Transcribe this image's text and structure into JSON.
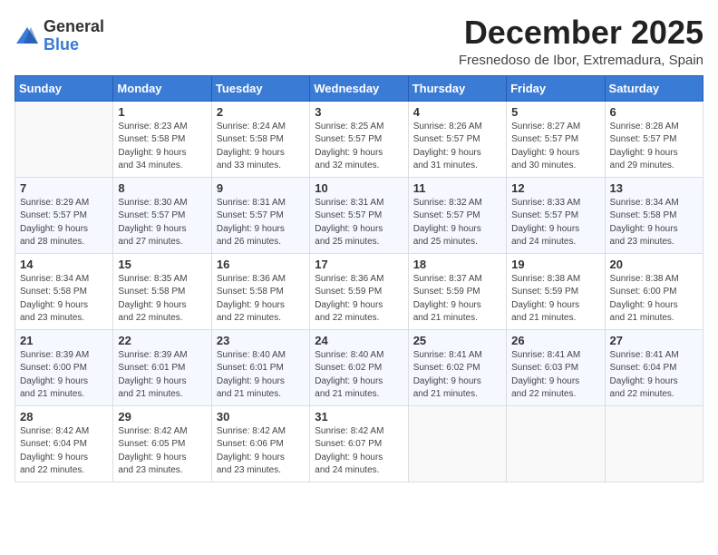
{
  "header": {
    "logo_general": "General",
    "logo_blue": "Blue",
    "month_title": "December 2025",
    "location": "Fresnedoso de Ibor, Extremadura, Spain"
  },
  "weekdays": [
    "Sunday",
    "Monday",
    "Tuesday",
    "Wednesday",
    "Thursday",
    "Friday",
    "Saturday"
  ],
  "weeks": [
    [
      {
        "day": "",
        "info": ""
      },
      {
        "day": "1",
        "info": "Sunrise: 8:23 AM\nSunset: 5:58 PM\nDaylight: 9 hours\nand 34 minutes."
      },
      {
        "day": "2",
        "info": "Sunrise: 8:24 AM\nSunset: 5:58 PM\nDaylight: 9 hours\nand 33 minutes."
      },
      {
        "day": "3",
        "info": "Sunrise: 8:25 AM\nSunset: 5:57 PM\nDaylight: 9 hours\nand 32 minutes."
      },
      {
        "day": "4",
        "info": "Sunrise: 8:26 AM\nSunset: 5:57 PM\nDaylight: 9 hours\nand 31 minutes."
      },
      {
        "day": "5",
        "info": "Sunrise: 8:27 AM\nSunset: 5:57 PM\nDaylight: 9 hours\nand 30 minutes."
      },
      {
        "day": "6",
        "info": "Sunrise: 8:28 AM\nSunset: 5:57 PM\nDaylight: 9 hours\nand 29 minutes."
      }
    ],
    [
      {
        "day": "7",
        "info": "Sunrise: 8:29 AM\nSunset: 5:57 PM\nDaylight: 9 hours\nand 28 minutes."
      },
      {
        "day": "8",
        "info": "Sunrise: 8:30 AM\nSunset: 5:57 PM\nDaylight: 9 hours\nand 27 minutes."
      },
      {
        "day": "9",
        "info": "Sunrise: 8:31 AM\nSunset: 5:57 PM\nDaylight: 9 hours\nand 26 minutes."
      },
      {
        "day": "10",
        "info": "Sunrise: 8:31 AM\nSunset: 5:57 PM\nDaylight: 9 hours\nand 25 minutes."
      },
      {
        "day": "11",
        "info": "Sunrise: 8:32 AM\nSunset: 5:57 PM\nDaylight: 9 hours\nand 25 minutes."
      },
      {
        "day": "12",
        "info": "Sunrise: 8:33 AM\nSunset: 5:57 PM\nDaylight: 9 hours\nand 24 minutes."
      },
      {
        "day": "13",
        "info": "Sunrise: 8:34 AM\nSunset: 5:58 PM\nDaylight: 9 hours\nand 23 minutes."
      }
    ],
    [
      {
        "day": "14",
        "info": "Sunrise: 8:34 AM\nSunset: 5:58 PM\nDaylight: 9 hours\nand 23 minutes."
      },
      {
        "day": "15",
        "info": "Sunrise: 8:35 AM\nSunset: 5:58 PM\nDaylight: 9 hours\nand 22 minutes."
      },
      {
        "day": "16",
        "info": "Sunrise: 8:36 AM\nSunset: 5:58 PM\nDaylight: 9 hours\nand 22 minutes."
      },
      {
        "day": "17",
        "info": "Sunrise: 8:36 AM\nSunset: 5:59 PM\nDaylight: 9 hours\nand 22 minutes."
      },
      {
        "day": "18",
        "info": "Sunrise: 8:37 AM\nSunset: 5:59 PM\nDaylight: 9 hours\nand 21 minutes."
      },
      {
        "day": "19",
        "info": "Sunrise: 8:38 AM\nSunset: 5:59 PM\nDaylight: 9 hours\nand 21 minutes."
      },
      {
        "day": "20",
        "info": "Sunrise: 8:38 AM\nSunset: 6:00 PM\nDaylight: 9 hours\nand 21 minutes."
      }
    ],
    [
      {
        "day": "21",
        "info": "Sunrise: 8:39 AM\nSunset: 6:00 PM\nDaylight: 9 hours\nand 21 minutes."
      },
      {
        "day": "22",
        "info": "Sunrise: 8:39 AM\nSunset: 6:01 PM\nDaylight: 9 hours\nand 21 minutes."
      },
      {
        "day": "23",
        "info": "Sunrise: 8:40 AM\nSunset: 6:01 PM\nDaylight: 9 hours\nand 21 minutes."
      },
      {
        "day": "24",
        "info": "Sunrise: 8:40 AM\nSunset: 6:02 PM\nDaylight: 9 hours\nand 21 minutes."
      },
      {
        "day": "25",
        "info": "Sunrise: 8:41 AM\nSunset: 6:02 PM\nDaylight: 9 hours\nand 21 minutes."
      },
      {
        "day": "26",
        "info": "Sunrise: 8:41 AM\nSunset: 6:03 PM\nDaylight: 9 hours\nand 22 minutes."
      },
      {
        "day": "27",
        "info": "Sunrise: 8:41 AM\nSunset: 6:04 PM\nDaylight: 9 hours\nand 22 minutes."
      }
    ],
    [
      {
        "day": "28",
        "info": "Sunrise: 8:42 AM\nSunset: 6:04 PM\nDaylight: 9 hours\nand 22 minutes."
      },
      {
        "day": "29",
        "info": "Sunrise: 8:42 AM\nSunset: 6:05 PM\nDaylight: 9 hours\nand 23 minutes."
      },
      {
        "day": "30",
        "info": "Sunrise: 8:42 AM\nSunset: 6:06 PM\nDaylight: 9 hours\nand 23 minutes."
      },
      {
        "day": "31",
        "info": "Sunrise: 8:42 AM\nSunset: 6:07 PM\nDaylight: 9 hours\nand 24 minutes."
      },
      {
        "day": "",
        "info": ""
      },
      {
        "day": "",
        "info": ""
      },
      {
        "day": "",
        "info": ""
      }
    ]
  ]
}
